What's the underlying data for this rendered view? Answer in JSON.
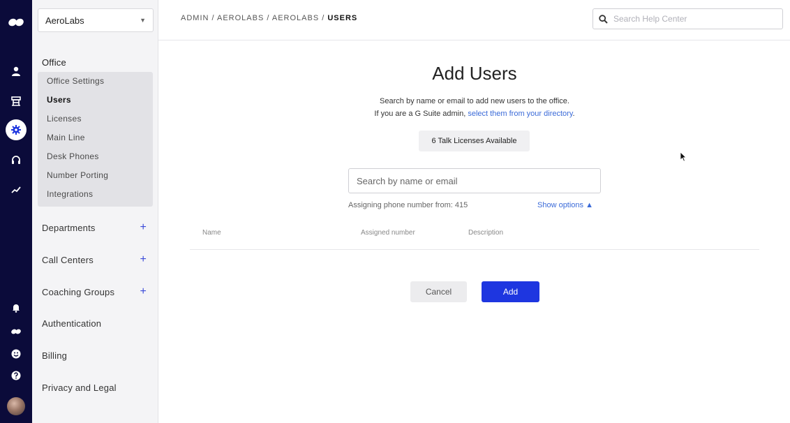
{
  "rail": {
    "icons": [
      "dialpad-logo-icon",
      "person-icon",
      "office-building-icon",
      "gear-icon",
      "headset-icon",
      "trend-chart-icon",
      "bell-icon",
      "dialpad-small-icon",
      "smiley-icon",
      "help-icon",
      "avatar"
    ]
  },
  "sidebar": {
    "org_select": "AeroLabs",
    "office_title": "Office",
    "office_items": [
      "Office Settings",
      "Users",
      "Licenses",
      "Main Line",
      "Desk Phones",
      "Number Porting",
      "Integrations"
    ],
    "departments": "Departments",
    "call_centers": "Call Centers",
    "coaching_groups": "Coaching Groups",
    "authentication": "Authentication",
    "billing": "Billing",
    "privacy": "Privacy and Legal",
    "plus": "+"
  },
  "topbar": {
    "breadcrumb_prefix": "ADMIN / AEROLABS / AEROLABS / ",
    "breadcrumb_current": "USERS",
    "help_placeholder": "Search Help Center"
  },
  "main": {
    "title": "Add Users",
    "description_line1": "Search by name or email to add new users to the office.",
    "description_line2_prefix": "If you are a G Suite admin, ",
    "description_line2_link": "select them from your directory",
    "description_line2_suffix": ".",
    "licenses_badge": "6 Talk Licenses Available",
    "search_placeholder": "Search by name or email",
    "assigning_text": "Assigning phone number from: 415",
    "show_options": "Show options ▲",
    "columns": [
      "Name",
      "Assigned number",
      "Description"
    ],
    "cancel_label": "Cancel",
    "add_label": "Add"
  },
  "colors": {
    "rail_bg": "#0b0b3a",
    "accent_blue": "#1e36e0",
    "link_blue": "#3a6ad8"
  }
}
